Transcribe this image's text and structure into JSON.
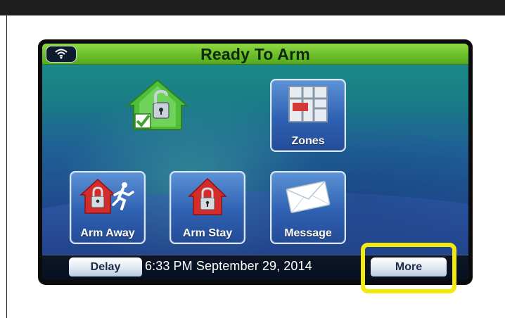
{
  "header": {
    "title": "Ready To Arm"
  },
  "tiles": {
    "zones": "Zones",
    "arm_away": "Arm Away",
    "arm_stay": "Arm Stay",
    "message": "Message"
  },
  "footer": {
    "delay": "Delay",
    "datetime": "6:33 PM September 29, 2014",
    "more": "More"
  },
  "icons": {
    "status": "wifi-icon",
    "house": "house-unlocked-check-icon",
    "zones": "zones-grid-icon",
    "arm_away": "house-lock-runner-icon",
    "arm_stay": "house-lock-icon",
    "message": "envelope-icon"
  },
  "colors": {
    "header": "#6cbf2a",
    "highlight": "#f2ea0e",
    "tile": "#2f61b2"
  }
}
